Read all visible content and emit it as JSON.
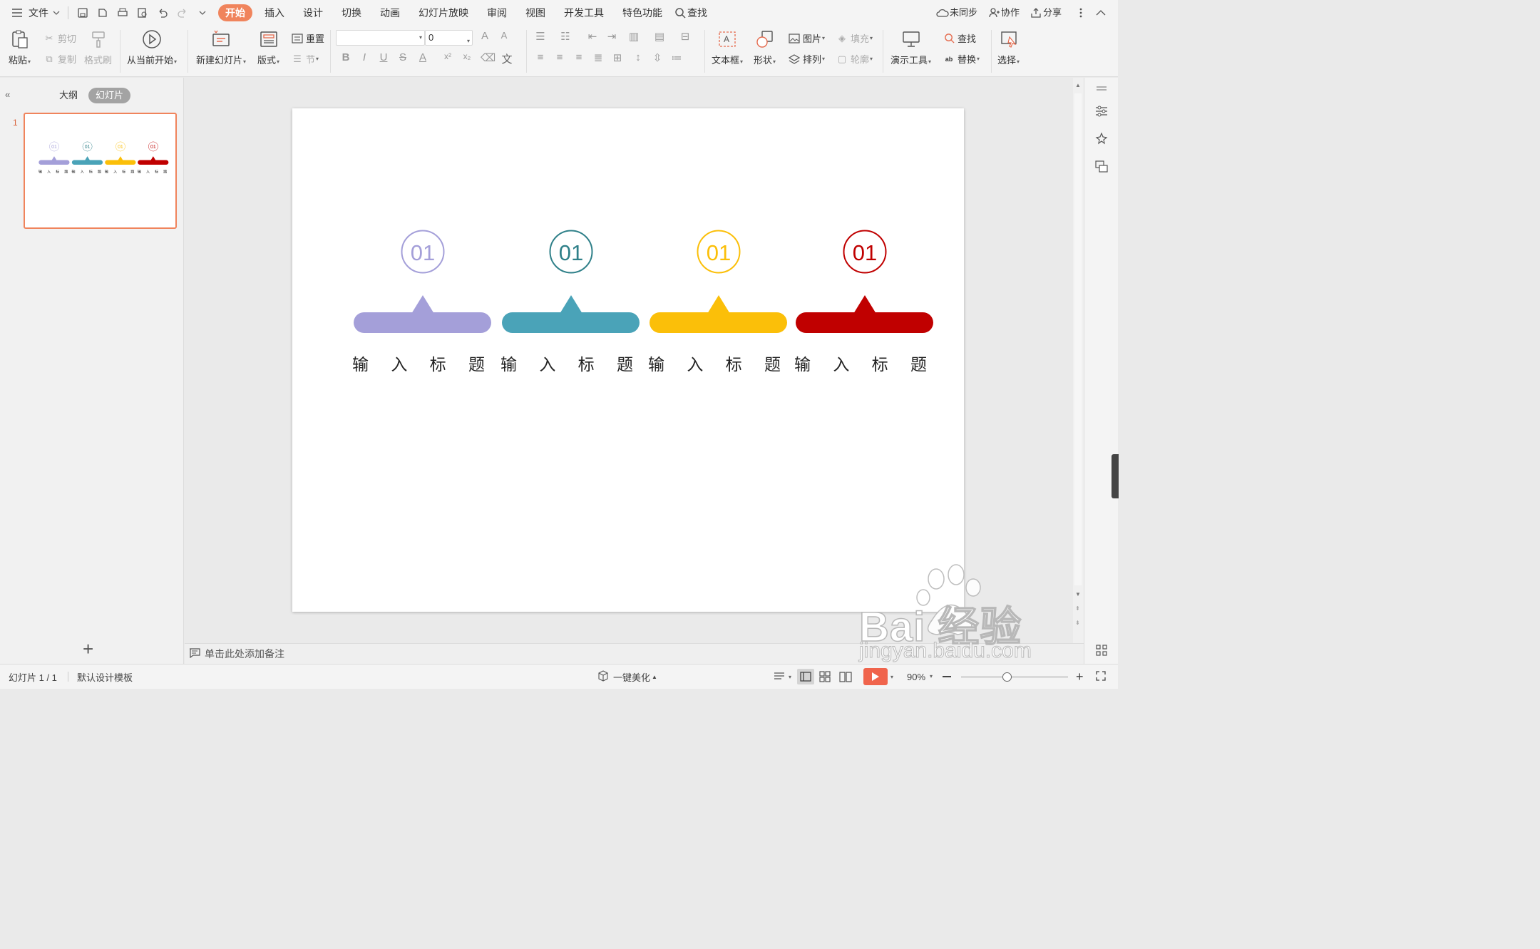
{
  "menubar": {
    "file": "文件",
    "tabs": [
      "开始",
      "插入",
      "设计",
      "切换",
      "动画",
      "幻灯片放映",
      "审阅",
      "视图",
      "开发工具",
      "特色功能"
    ],
    "active_tab": "开始",
    "search": "查找",
    "sync": "未同步",
    "collab": "协作",
    "share": "分享"
  },
  "ribbon": {
    "paste": "粘贴",
    "cut": "剪切",
    "copy": "复制",
    "format_painter": "格式刷",
    "play_from_current": "从当前开始",
    "new_slide": "新建幻灯片",
    "layout": "版式",
    "reset": "重置",
    "section": "节",
    "font_size_value": "0",
    "textbox": "文本框",
    "shape": "形状",
    "picture": "图片",
    "fill": "填充",
    "arrange": "排列",
    "outline": "轮廓",
    "presenter_tools": "演示工具",
    "find": "查找",
    "replace": "替换",
    "select": "选择"
  },
  "left_panel": {
    "tab_outline": "大纲",
    "tab_slides": "幻灯片",
    "slide_number": "1",
    "add": "+"
  },
  "slide": {
    "items": [
      {
        "number": "01",
        "title": "输 入 标 题",
        "color": "#a49fd9"
      },
      {
        "number": "01",
        "title": "输 入 标 题",
        "color": "#4aa3b8"
      },
      {
        "number": "01",
        "title": "输 入 标 题",
        "color": "#fbbf09"
      },
      {
        "number": "01",
        "title": "输 入 标 题",
        "color": "#c00000"
      }
    ],
    "circle_colors": [
      "#a49fd9",
      "#2f8089",
      "#fbbf09",
      "#c00000"
    ]
  },
  "notes_placeholder": "单击此处添加备注",
  "statusbar": {
    "slide_info": "幻灯片 1 / 1",
    "template": "默认设计模板",
    "beautify": "一键美化",
    "zoom": "90%"
  },
  "watermark": {
    "brand": "Bai 经验",
    "url": "jingyan.baidu.com"
  },
  "colors": {
    "accent": "#f0845c",
    "play": "#f0644c"
  }
}
